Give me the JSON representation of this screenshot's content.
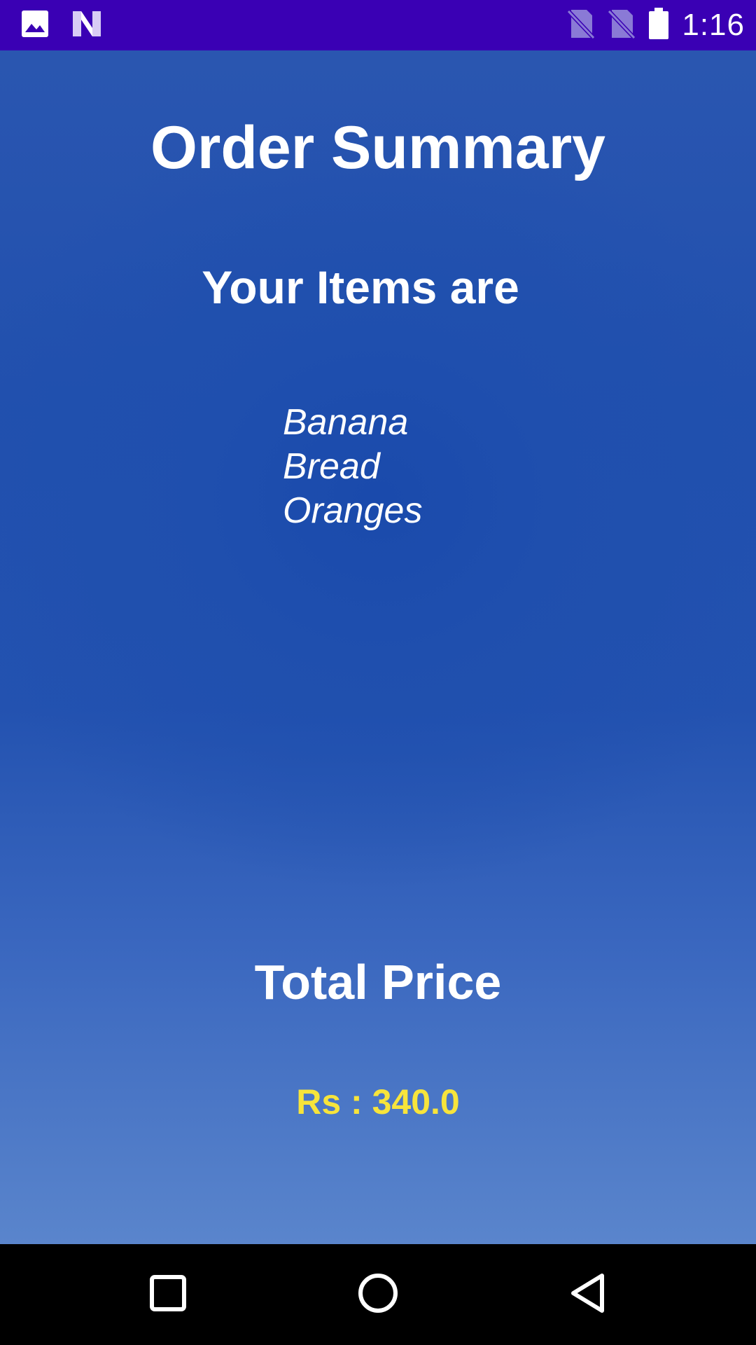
{
  "status_bar": {
    "time": "1:16",
    "left_icons": [
      "image-icon",
      "n-logo-icon"
    ],
    "right_icons": [
      "no-sim-icon",
      "no-sim-icon",
      "battery-icon"
    ],
    "background": "#3a00b4"
  },
  "main": {
    "title": "Order Summary",
    "subtitle": "Your Items are",
    "items": [
      "Banana",
      "Bread",
      "Oranges"
    ],
    "total_label": "Total Price",
    "total_value": "Rs : 340.0",
    "accent_color": "#f7e43b"
  },
  "nav_bar": {
    "buttons": [
      "recent-apps-icon",
      "home-icon",
      "back-icon"
    ]
  }
}
